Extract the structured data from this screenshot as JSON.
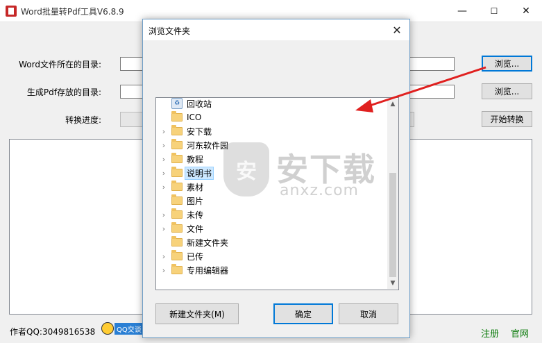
{
  "window": {
    "title": "Word批量转Pdf工具V6.8.9",
    "minimize": "—",
    "maximize": "☐",
    "close": "✕"
  },
  "form": {
    "source_label": "Word文件所在的目录:",
    "source_value": "",
    "output_label": "生成Pdf存放的目录:",
    "output_value": "",
    "browse_label": "浏览...",
    "progress_label": "转换进度:",
    "progress": 0,
    "start_label": "开始转换"
  },
  "footer": {
    "author_label": "作者QQ:",
    "author_qq": "3049816538",
    "qq_badge": "QQ交谈",
    "register": "注册",
    "website": "官网"
  },
  "dialog": {
    "title": "浏览文件夹",
    "close": "✕",
    "tree": [
      {
        "label": "回收站",
        "icon": "recycle-bin-icon",
        "expandable": false
      },
      {
        "label": "ICO",
        "icon": "folder-icon",
        "expandable": false
      },
      {
        "label": "安下载",
        "icon": "folder-icon",
        "expandable": true
      },
      {
        "label": "河东软件园",
        "icon": "folder-icon",
        "expandable": true
      },
      {
        "label": "教程",
        "icon": "folder-icon",
        "expandable": true
      },
      {
        "label": "说明书",
        "icon": "folder-icon",
        "expandable": true,
        "selected": true
      },
      {
        "label": "素材",
        "icon": "folder-icon",
        "expandable": true
      },
      {
        "label": "图片",
        "icon": "folder-icon",
        "expandable": false
      },
      {
        "label": "未传",
        "icon": "folder-icon",
        "expandable": true
      },
      {
        "label": "文件",
        "icon": "folder-icon",
        "expandable": true
      },
      {
        "label": "新建文件夹",
        "icon": "folder-icon",
        "expandable": false
      },
      {
        "label": "已传",
        "icon": "folder-icon",
        "expandable": true
      },
      {
        "label": "专用编辑器",
        "icon": "folder-icon",
        "expandable": true
      }
    ],
    "new_folder": "新建文件夹(M)",
    "ok": "确定",
    "cancel": "取消"
  },
  "watermark": {
    "text": "安下载",
    "url": "anxz.com",
    "shield_char": "安"
  },
  "colors": {
    "accent": "#0078d7",
    "arrow": "#e0201f",
    "link": "#0a7a0a"
  }
}
